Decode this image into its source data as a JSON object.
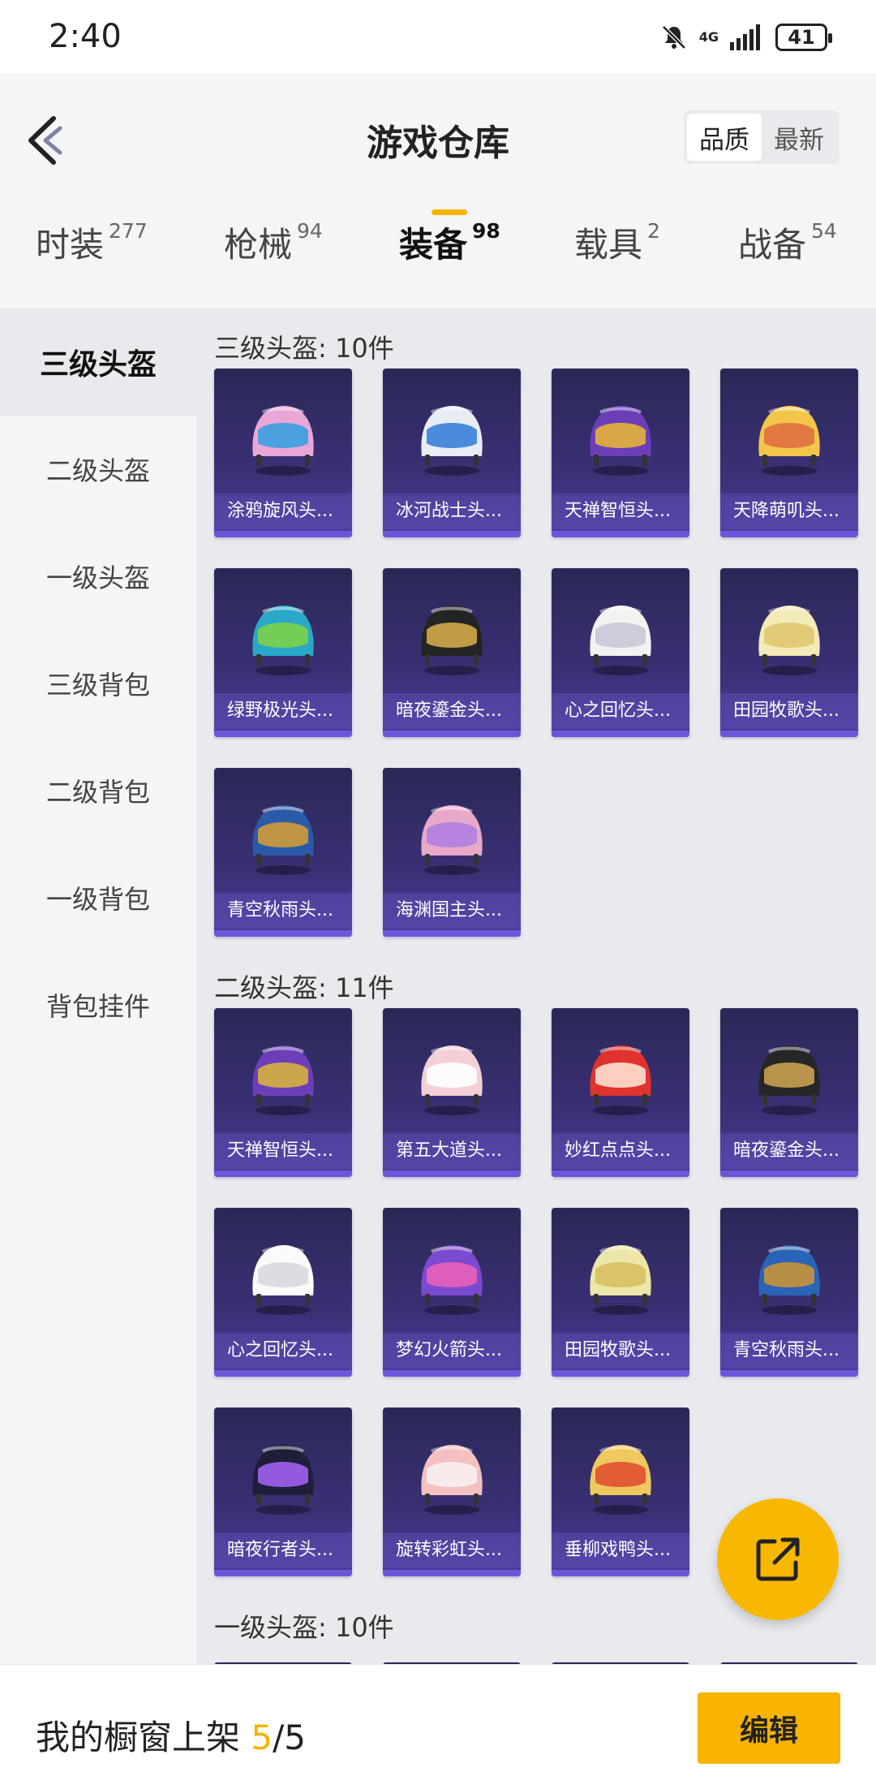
{
  "status_bar": {
    "time": "2:40",
    "network": "4G",
    "battery": "41"
  },
  "header": {
    "title": "游戏仓库",
    "sort_options": [
      {
        "label": "品质",
        "active": true
      },
      {
        "label": "最新",
        "active": false
      }
    ]
  },
  "tabs": [
    {
      "label": "时装",
      "count": "277",
      "active": false
    },
    {
      "label": "枪械",
      "count": "94",
      "active": false
    },
    {
      "label": "装备",
      "count": "98",
      "active": true
    },
    {
      "label": "载具",
      "count": "2",
      "active": false
    },
    {
      "label": "战备",
      "count": "54",
      "active": false
    }
  ],
  "sidebar": {
    "items": [
      {
        "label": "三级头盔",
        "active": true
      },
      {
        "label": "二级头盔",
        "active": false
      },
      {
        "label": "一级头盔",
        "active": false
      },
      {
        "label": "三级背包",
        "active": false
      },
      {
        "label": "二级背包",
        "active": false
      },
      {
        "label": "一级背包",
        "active": false
      },
      {
        "label": "背包挂件",
        "active": false
      }
    ]
  },
  "sections": [
    {
      "title": "三级头盔: 10件",
      "items": [
        {
          "label": "涂鸦旋风头...",
          "icon": "helmet-pink-goggles-icon",
          "colors": [
            "#e9a7d8",
            "#3aa0e0"
          ]
        },
        {
          "label": "冰河战士头...",
          "icon": "helmet-white-blue-visor-icon",
          "colors": [
            "#e8ecf5",
            "#3b7fd8"
          ]
        },
        {
          "label": "天禅智恒头...",
          "icon": "helmet-purple-gold-icon",
          "colors": [
            "#6c3fb8",
            "#e5b33a"
          ]
        },
        {
          "label": "天降萌叽头...",
          "icon": "helmet-yellow-icon",
          "colors": [
            "#f2c64a",
            "#e07040"
          ]
        },
        {
          "label": "绿野极光头...",
          "icon": "helmet-green-blue-icon",
          "colors": [
            "#2aa8c8",
            "#7bd04a"
          ]
        },
        {
          "label": "暗夜鎏金头...",
          "icon": "helmet-black-gold-icon",
          "colors": [
            "#242424",
            "#d4a84a"
          ]
        },
        {
          "label": "心之回忆头...",
          "icon": "helmet-white-icon",
          "colors": [
            "#f2f2f2",
            "#c8c8d8"
          ]
        },
        {
          "label": "田园牧歌头...",
          "icon": "helmet-cream-flower-icon",
          "colors": [
            "#f4eab8",
            "#e0c870"
          ]
        },
        {
          "label": "青空秋雨头...",
          "icon": "helmet-navy-gold-icon",
          "colors": [
            "#2a5aa8",
            "#d09a3a"
          ]
        },
        {
          "label": "海渊国主头...",
          "icon": "helmet-pink-wings-icon",
          "colors": [
            "#e8a8c8",
            "#b080e0"
          ]
        }
      ]
    },
    {
      "title": "二级头盔: 11件",
      "items": [
        {
          "label": "天禅智恒头...",
          "icon": "helmet-purple-gold-icon",
          "colors": [
            "#6c3fb8",
            "#d8b040"
          ]
        },
        {
          "label": "第五大道头...",
          "icon": "helmet-pink-plaid-icon",
          "colors": [
            "#f4d0d6",
            "#ffffff"
          ]
        },
        {
          "label": "妙红点点头...",
          "icon": "helmet-red-icon",
          "colors": [
            "#e0322e",
            "#ffe0d0"
          ]
        },
        {
          "label": "暗夜鎏金头...",
          "icon": "helmet-black-gold-icon",
          "colors": [
            "#262626",
            "#c9a050"
          ]
        },
        {
          "label": "心之回忆头...",
          "icon": "helmet-white-icon",
          "colors": [
            "#fafafa",
            "#d8d8e0"
          ]
        },
        {
          "label": "梦幻火箭头...",
          "icon": "helmet-purple-rocket-icon",
          "colors": [
            "#7a4ad0",
            "#e860b8"
          ]
        },
        {
          "label": "田园牧歌头...",
          "icon": "helmet-cream-flower-icon",
          "colors": [
            "#ece6a8",
            "#d8c060"
          ]
        },
        {
          "label": "青空秋雨头...",
          "icon": "helmet-navy-gold-icon",
          "colors": [
            "#2a64b8",
            "#c8923a"
          ]
        },
        {
          "label": "暗夜行者头...",
          "icon": "helmet-dark-neon-icon",
          "colors": [
            "#1e1e3a",
            "#a060f0"
          ]
        },
        {
          "label": "旋转彩虹头...",
          "icon": "helmet-pink-pearl-icon",
          "colors": [
            "#f4c0c0",
            "#f8f0f0"
          ]
        },
        {
          "label": "垂柳戏鸭头...",
          "icon": "helmet-yellow-duck-icon",
          "colors": [
            "#f0c860",
            "#e05030"
          ]
        }
      ]
    },
    {
      "title": "一级头盔: 10件",
      "items": []
    }
  ],
  "fab": {
    "icon": "share-external-icon",
    "color": "#f8b700"
  },
  "bottom_bar": {
    "label": "我的橱窗上架",
    "count_current": "5",
    "count_separator": "/",
    "count_total": "5",
    "edit_label": "编辑"
  },
  "accent_color": "#f5b400"
}
